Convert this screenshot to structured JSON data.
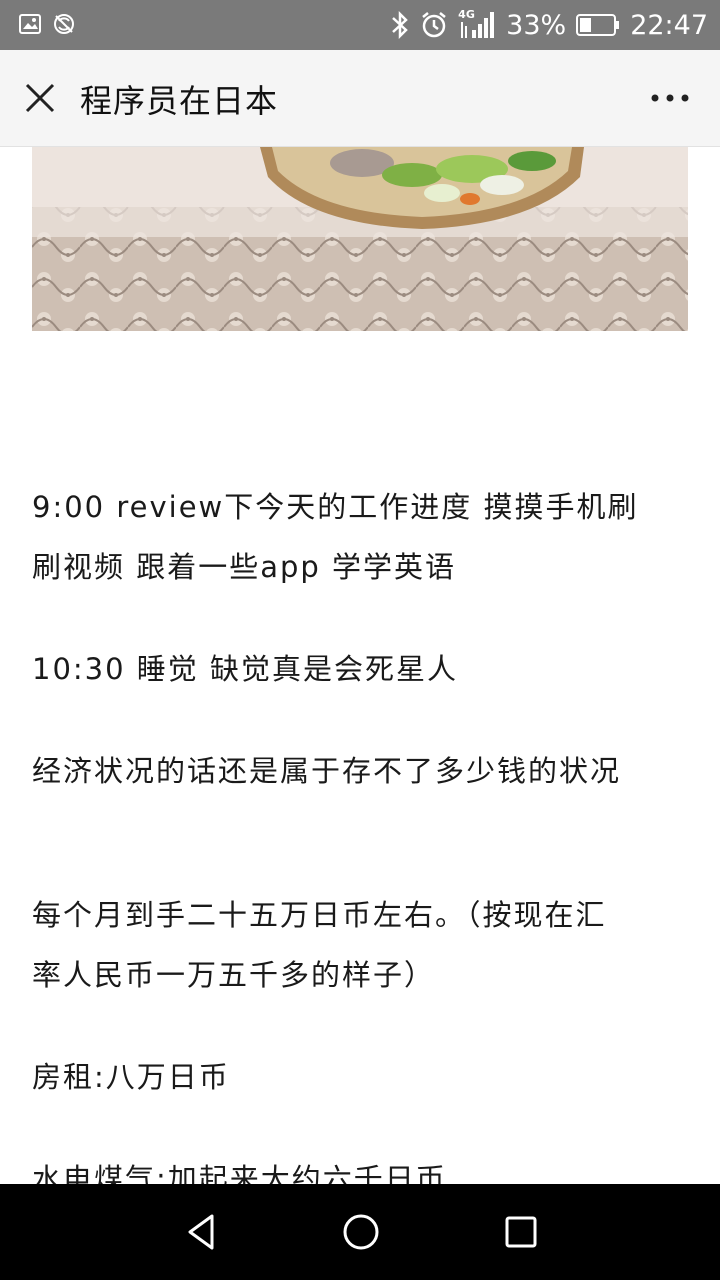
{
  "status_bar": {
    "network": "4G",
    "battery": "33%",
    "time": "22:47",
    "icons": [
      "image-icon",
      "sync-off-icon",
      "bluetooth-icon",
      "alarm-icon",
      "signal-icon",
      "battery-icon"
    ]
  },
  "header": {
    "title": "程序员在日本",
    "close_icon": "close-icon",
    "more_icon": "more-icon"
  },
  "article": {
    "paragraphs": [
      "9:00 review下今天的工作进度 摸摸手机刷",
      "刷视频 跟着一些app 学学英语",
      "10:30 睡觉 缺觉真是会死星人",
      "经济状况的话还是属于存不了多少钱的状况",
      "每个月到手二十五万日币左右。（按现在汇",
      "率人民币一万五千多的样子）",
      "房租:八万日币",
      "水电煤气:加起来大约六千日币"
    ]
  },
  "nav_bar": {
    "icons": [
      "back-icon",
      "home-icon",
      "recents-icon"
    ]
  },
  "colors": {
    "status_bar": "#7a7a7a",
    "title_bar": "#f5f5f5",
    "text": "#1a1a1a",
    "nav_bar": "#000000"
  }
}
